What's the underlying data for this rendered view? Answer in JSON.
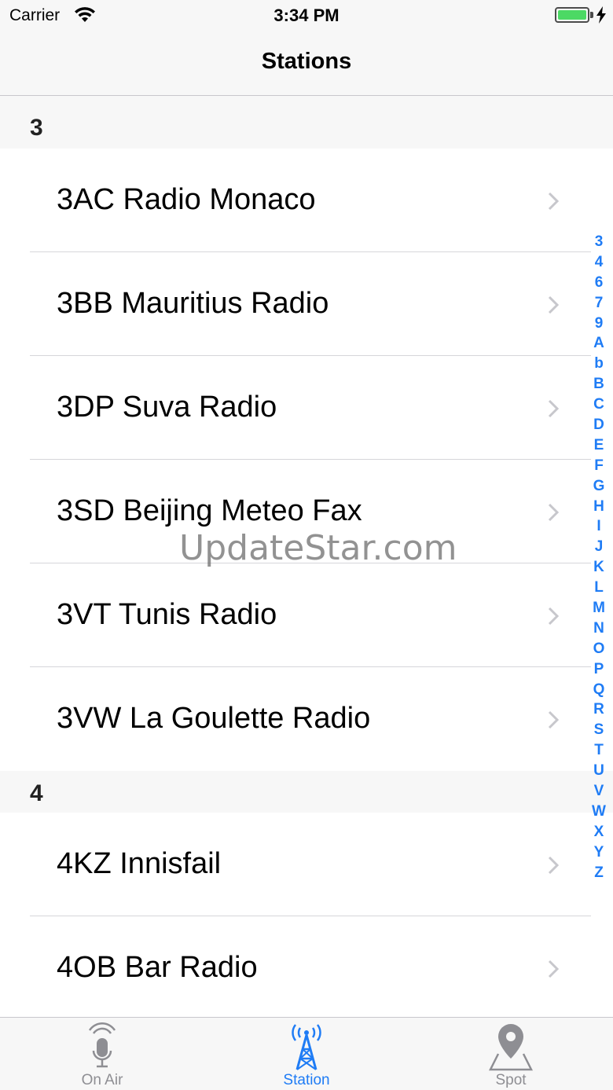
{
  "status_bar": {
    "carrier": "Carrier",
    "time": "3:34 PM",
    "battery_color": "#4cd964"
  },
  "nav": {
    "title": "Stations"
  },
  "sections": [
    {
      "title": "3",
      "rows": [
        "3AC Radio Monaco",
        "3BB Mauritius Radio",
        "3DP Suva Radio",
        "3SD Beijing Meteo Fax",
        "3VT Tunis Radio",
        "3VW La Goulette Radio"
      ]
    },
    {
      "title": "4",
      "rows": [
        "4KZ Innisfail",
        "4OB Bar Radio"
      ]
    }
  ],
  "index": [
    "3",
    "4",
    "6",
    "7",
    "9",
    "A",
    "b",
    "B",
    "C",
    "D",
    "E",
    "F",
    "G",
    "H",
    "I",
    "J",
    "K",
    "L",
    "M",
    "N",
    "O",
    "P",
    "Q",
    "R",
    "S",
    "T",
    "U",
    "V",
    "W",
    "X",
    "Y",
    "Z"
  ],
  "watermark": "UpdateStar.com",
  "tabs": [
    {
      "label": "On Air",
      "icon": "microphone-icon",
      "active": false
    },
    {
      "label": "Station",
      "icon": "radio-tower-icon",
      "active": true
    },
    {
      "label": "Spot",
      "icon": "map-pin-icon",
      "active": false
    }
  ],
  "colors": {
    "accent": "#1f7cf5",
    "inactive": "#8e8e93",
    "header_bg": "#f7f7f7"
  }
}
